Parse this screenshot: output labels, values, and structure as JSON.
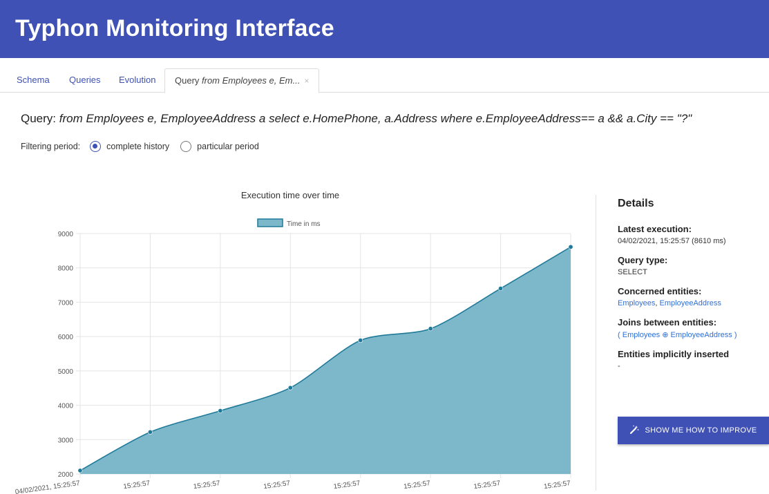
{
  "header": {
    "title": "Typhon Monitoring Interface"
  },
  "tabs": [
    {
      "label": "Schema"
    },
    {
      "label": "Queries"
    },
    {
      "label": "Evolution"
    },
    {
      "prefix": "Query ",
      "label_italic": "from Employees e, Em...",
      "close": "×"
    }
  ],
  "query": {
    "label": "Query:",
    "text": "from Employees e, EmployeeAddress a select e.HomePhone, a.Address where e.EmployeeAddress== a && a.City == \"?\""
  },
  "filter": {
    "label": "Filtering period:",
    "options": [
      {
        "label": "complete history",
        "checked": true
      },
      {
        "label": "particular period",
        "checked": false
      }
    ]
  },
  "chart_data": {
    "type": "area",
    "title": "Execution time over time",
    "legend": "Time in ms",
    "legend_position": "top-center",
    "x": [
      "04/02/2021, 15:25:57",
      "15:25:57",
      "15:25:57",
      "15:25:57",
      "15:25:57",
      "15:25:57",
      "15:25:57",
      "15:25:57"
    ],
    "series": [
      {
        "name": "Time in ms",
        "values": [
          2100,
          3220,
          3840,
          4510,
          5890,
          6230,
          7400,
          8610
        ]
      }
    ],
    "y_ticks": [
      "9000",
      "8000",
      "7000",
      "6000",
      "5000",
      "4000",
      "3000",
      "2000"
    ],
    "ylim": [
      2000,
      9000
    ],
    "grid": true,
    "colors": {
      "line": "#1f7a99",
      "fill": "#7db7ca",
      "point": "#1f7a99"
    }
  },
  "details": {
    "title": "Details",
    "latest_label": "Latest execution:",
    "latest_value": "04/02/2021, 15:25:57 (8610 ms)",
    "type_label": "Query type:",
    "type_value": "SELECT",
    "entities_label": "Concerned entities:",
    "entity_1": "Employees",
    "entity_sep": ", ",
    "entity_2": "EmployeeAddress",
    "joins_label": "Joins between entities:",
    "join_open": "( ",
    "join_left": "Employees",
    "join_symbol": " ⊕ ",
    "join_right": "EmployeeAddress",
    "join_close": " )",
    "implicit_label": "Entities implicitly inserted",
    "implicit_value": "-"
  },
  "improve_button": {
    "icon": "magic-wand-icon",
    "label": "SHOW ME HOW TO IMPROVE"
  },
  "colors": {
    "primary": "#3f51b5",
    "link": "#2f6fd6"
  }
}
